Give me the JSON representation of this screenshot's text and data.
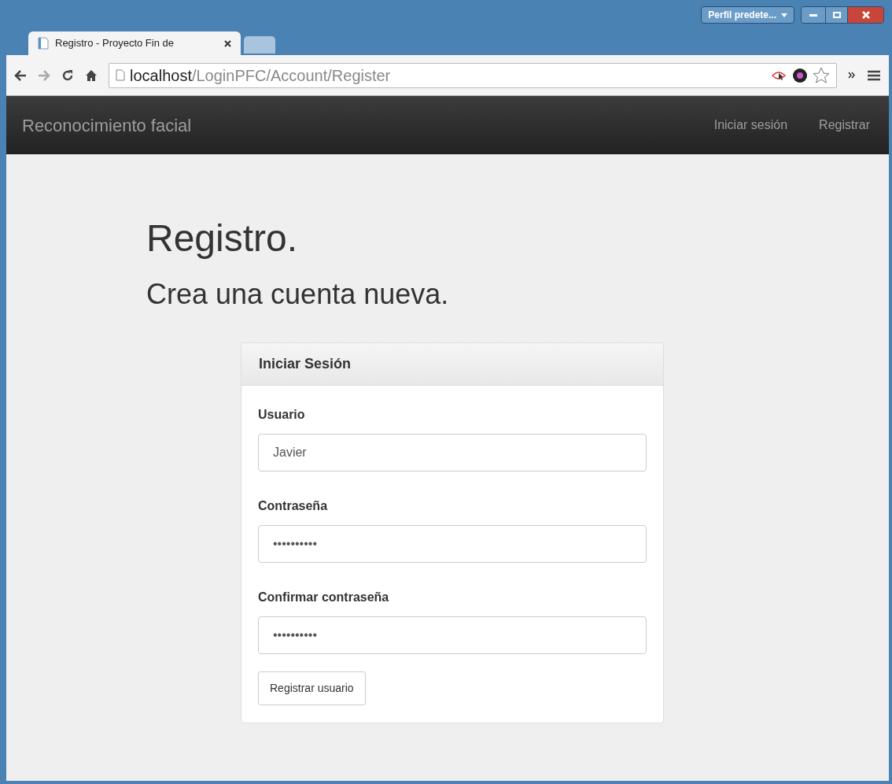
{
  "window": {
    "profile_button": "Perfil predete...",
    "tabs": [
      {
        "title": "Registro - Proyecto Fin de",
        "selected": true
      },
      {
        "selected": false
      }
    ]
  },
  "toolbar": {
    "url_host": "localhost",
    "url_path": "/LoginPFC/Account/Register"
  },
  "navbar": {
    "brand": "Reconocimiento facial",
    "links": [
      "Iniciar sesión",
      "Registrar"
    ]
  },
  "heading": "Registro.",
  "subheading": "Crea una cuenta nueva.",
  "panel": {
    "title": "Iniciar Sesión",
    "fields": [
      {
        "label": "Usuario",
        "value": "Javier"
      },
      {
        "label": "Contraseña",
        "value": "••••••••••"
      },
      {
        "label": "Confirmar contraseña",
        "value": "••••••••••"
      }
    ],
    "button": "Registrar usuario"
  }
}
